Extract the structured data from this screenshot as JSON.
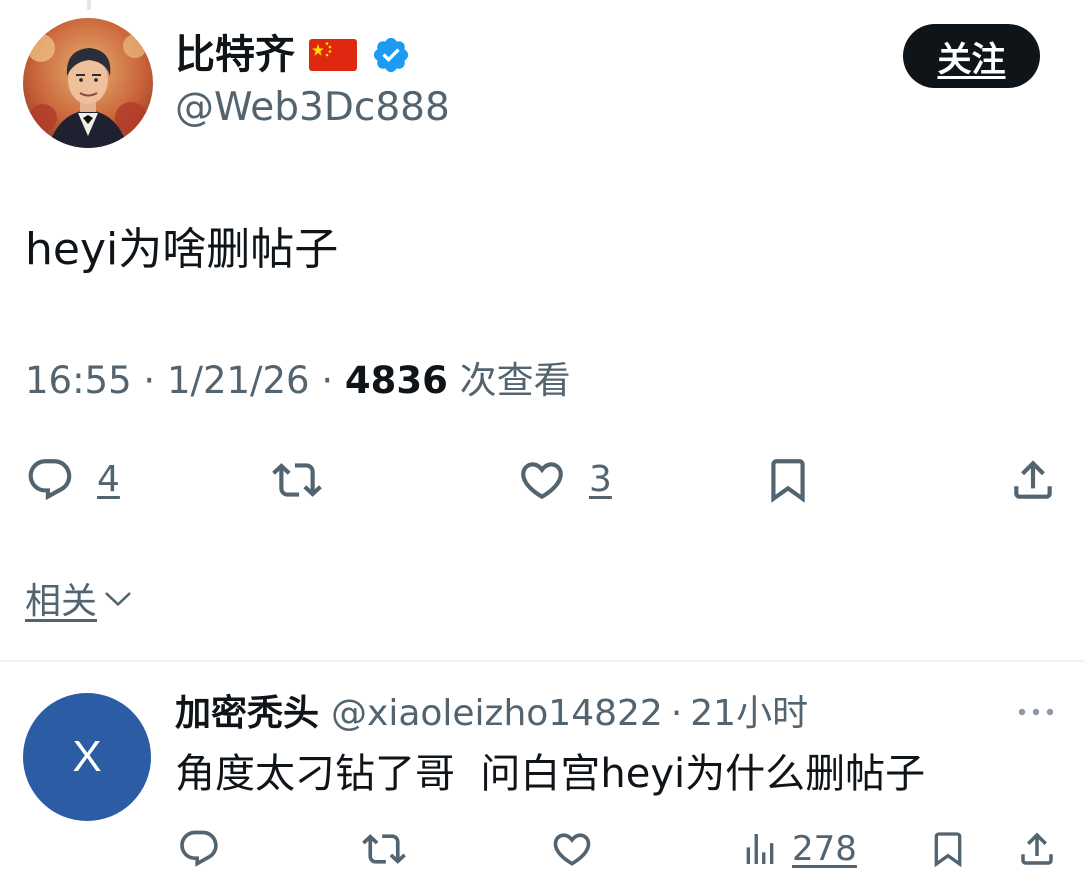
{
  "post": {
    "author_name": "比特齐",
    "author_handle": "@Web3Dc888",
    "follow_label": "关注",
    "text": "heyi为啥删帖子",
    "time": "16:55",
    "date": "1/21/26",
    "views": "4836",
    "views_label": "次查看",
    "separator": "·",
    "icons": {
      "flag": "china-flag-icon",
      "verified": "verified-badge-icon"
    },
    "actions": {
      "replies": "4",
      "likes": "3"
    }
  },
  "related": {
    "label": "相关"
  },
  "reply": {
    "avatar_initial": "X",
    "author_name": "加密秃头",
    "author_handle": "@xiaoleizho14822",
    "separator": "·",
    "time_ago": "21小时",
    "text": "角度太刁钻了哥  问白宫heyi为什么删帖子",
    "views": "278"
  },
  "colors": {
    "text_primary": "#0f1419",
    "text_secondary": "#536471",
    "verified_blue": "#1d9bf0",
    "reply_avatar_bg": "#2b5ca4",
    "follow_button_bg": "#0f1419"
  }
}
